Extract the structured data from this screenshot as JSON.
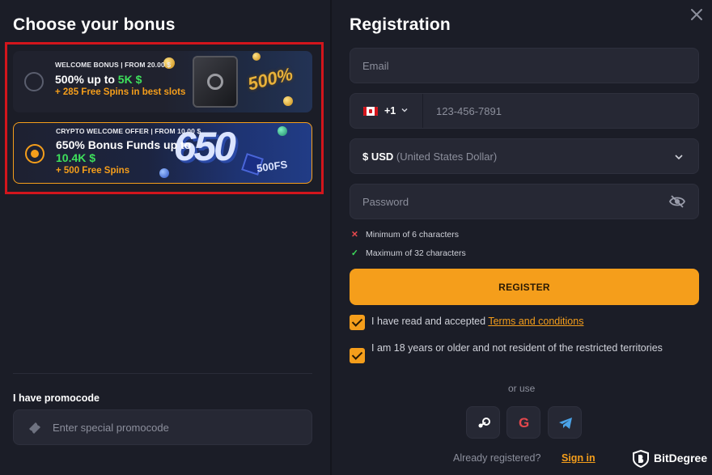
{
  "left": {
    "title": "Choose your bonus",
    "bonuses": [
      {
        "kicker": "WELCOME BONUS | FROM 20.00 $",
        "main_prefix": "500% up to ",
        "main_highlight": "5K $",
        "sub": "+ 285 Free Spins in best slots",
        "art_text": "500%",
        "selected": false
      },
      {
        "kicker": "CRYPTO WELCOME OFFER | FROM 10.00 $",
        "main_prefix": "650% Bonus Funds up to",
        "main_highlight": "10.4K $",
        "sub": "+ 500 Free Spins",
        "art_text": "650",
        "art_sub": "500FS",
        "selected": true
      }
    ],
    "promo": {
      "label": "I have promocode",
      "placeholder": "Enter special promocode",
      "icon": "ticket-icon"
    }
  },
  "registration": {
    "title": "Registration",
    "email_placeholder": "Email",
    "phone": {
      "country": "Canada",
      "dial_code": "+1",
      "placeholder": "123-456-7891"
    },
    "currency": {
      "symbol_code": "$ USD",
      "name": "(United States Dollar)"
    },
    "password_placeholder": "Password",
    "rules": [
      {
        "mark": "✕",
        "text": "Minimum of 6 characters",
        "status": "fail"
      },
      {
        "mark": "✓",
        "text": "Maximum of 32 characters",
        "status": "pass"
      }
    ],
    "register_label": "REGISTER",
    "terms_prefix": "I have read and accepted ",
    "terms_link": "Terms and conditions",
    "age_text": "I am 18 years or older and not resident of the restricted territories",
    "or_use": "or use",
    "social": [
      "steam-icon",
      "google-icon",
      "telegram-icon"
    ],
    "google_letter": "G",
    "already": "Already registered?",
    "sign_in": "Sign in"
  },
  "watermark": {
    "text": "BitDegree"
  },
  "colors": {
    "background": "#1b1d27",
    "field": "#262834",
    "accent": "#f59e1b",
    "highlight_border": "#d3151c",
    "bonus_green": "#3ee05c"
  }
}
